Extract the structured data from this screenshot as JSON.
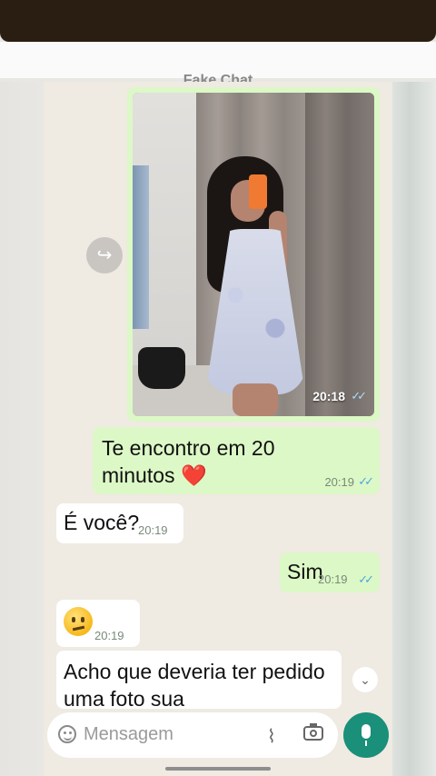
{
  "header": {
    "title": "Fake Chat"
  },
  "messages": {
    "photo": {
      "time": "20:18",
      "ticks": "✓✓"
    },
    "m1": {
      "text": "Te encontro em 20 minutos",
      "emoji": "❤️",
      "time": "20:19",
      "ticks": "✓✓"
    },
    "m2": {
      "text": "É você?",
      "time": "20:19"
    },
    "m3": {
      "text": "Sim",
      "time": "20:19",
      "ticks": "✓✓"
    },
    "m4": {
      "emoji_name": "neutral-face",
      "time": "20:19"
    },
    "m5": {
      "text": "Acho que deveria ter pedido uma foto sua"
    }
  },
  "input": {
    "placeholder": "Mensagem"
  },
  "colors": {
    "outgoing": "#dcf8c6",
    "incoming": "#ffffff",
    "accent": "#1a8f79",
    "ticks": "#4fa6e0"
  }
}
